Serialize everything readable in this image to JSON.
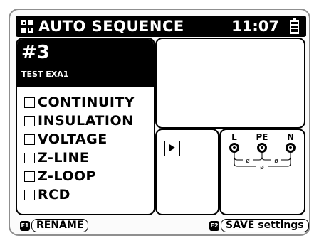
{
  "header": {
    "title": "AUTO SEQUENCE",
    "time": "11:07"
  },
  "sequence": {
    "number": "#3",
    "name": "TEST EXA1",
    "tests": [
      {
        "label": "CONTINUITY"
      },
      {
        "label": "INSULATION"
      },
      {
        "label": "VOLTAGE"
      },
      {
        "label": "Z-LINE"
      },
      {
        "label": "Z-LOOP"
      },
      {
        "label": "RCD"
      }
    ]
  },
  "terminals": {
    "labels": [
      "L",
      "PE",
      "N"
    ],
    "readings": [
      "ø",
      "ø",
      "ø"
    ]
  },
  "footer": {
    "f1": {
      "key": "F1",
      "label": "RENAME"
    },
    "f2": {
      "key": "F2",
      "label": "SAVE settings"
    }
  }
}
